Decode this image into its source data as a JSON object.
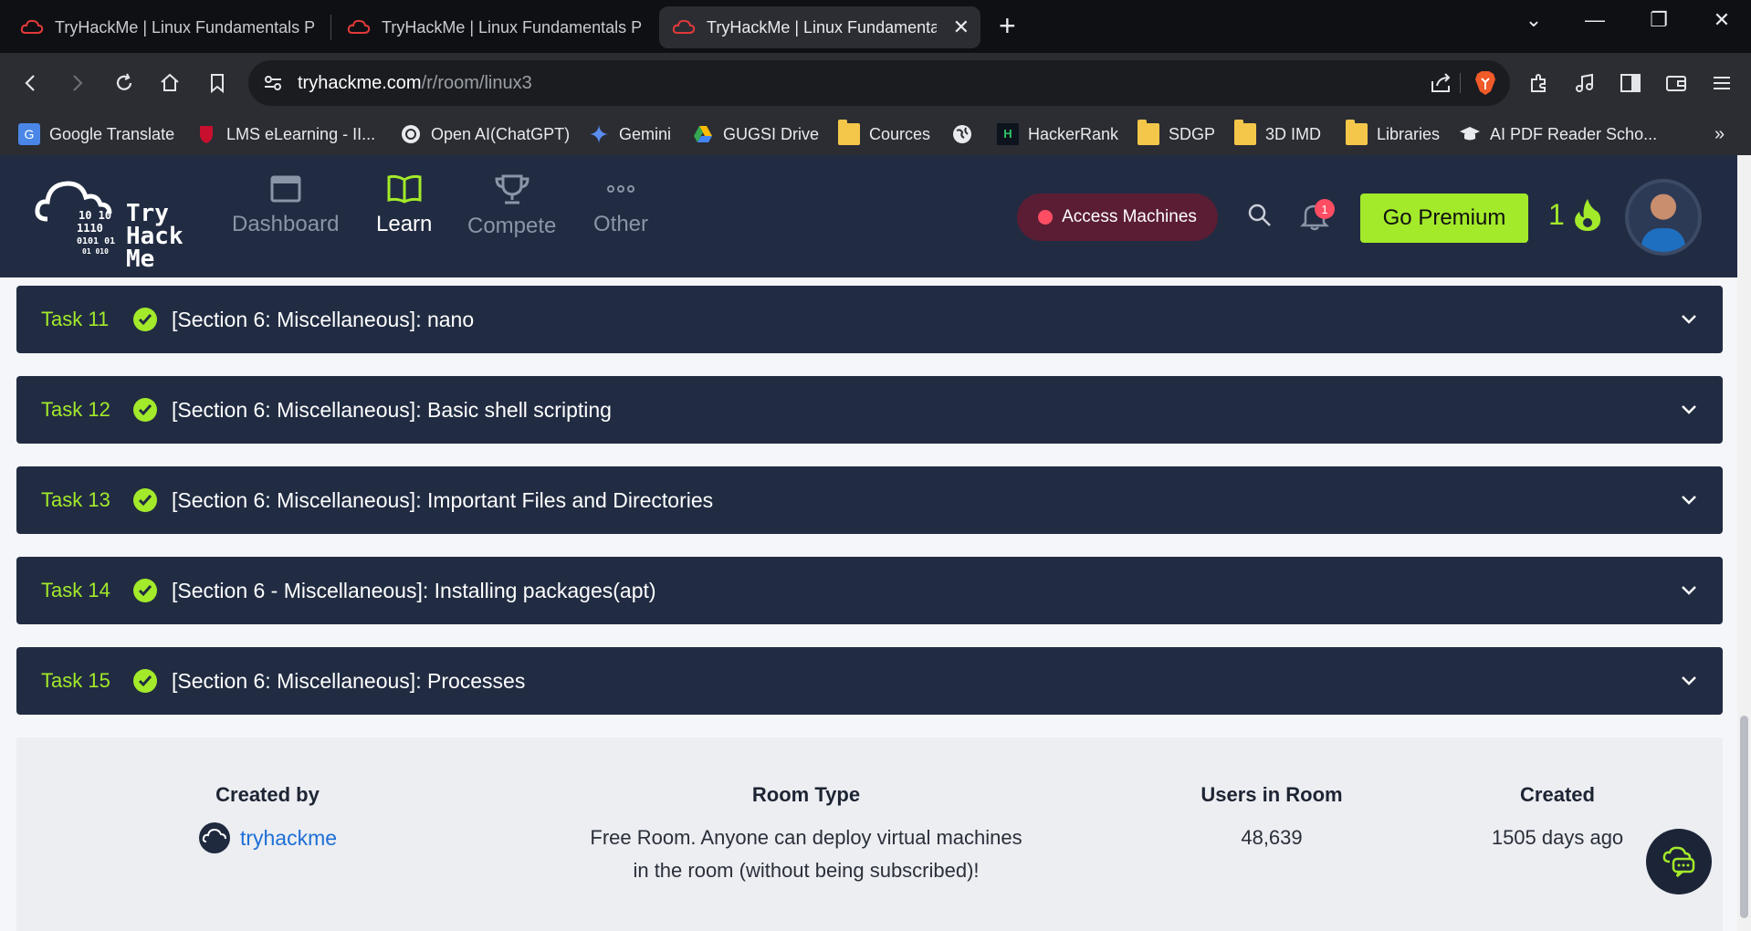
{
  "browser": {
    "tabs": [
      {
        "title": "TryHackMe | Linux Fundamentals Par",
        "active": false
      },
      {
        "title": "TryHackMe | Linux Fundamentals Par",
        "active": false
      },
      {
        "title": "TryHackMe | Linux Fundamental",
        "active": true
      }
    ],
    "url_host": "tryhackme.com",
    "url_path": "/r/room/linux3",
    "bookmarks": [
      {
        "label": "Google Translate",
        "icon": "google-translate-icon"
      },
      {
        "label": "LMS eLearning - II...",
        "icon": "shield-icon"
      },
      {
        "label": "Open AI(ChatGPT)",
        "icon": "openai-icon"
      },
      {
        "label": "Gemini",
        "icon": "gemini-icon"
      },
      {
        "label": "GUGSI Drive",
        "icon": "drive-icon"
      },
      {
        "label": "Cources",
        "icon": "folder-icon"
      },
      {
        "label": "",
        "icon": "globe-icon"
      },
      {
        "label": "HackerRank",
        "icon": "hackerrank-icon"
      },
      {
        "label": "SDGP",
        "icon": "folder-icon"
      },
      {
        "label": "3D IMD",
        "icon": "folder-icon"
      },
      {
        "label": "Libraries",
        "icon": "folder-icon"
      },
      {
        "label": "AI PDF Reader Scho...",
        "icon": "graduation-cap-icon"
      }
    ]
  },
  "header": {
    "logo_text": [
      "Try",
      "Hack",
      "Me"
    ],
    "nav": [
      {
        "label": "Dashboard",
        "icon": "window-icon",
        "active": false
      },
      {
        "label": "Learn",
        "icon": "book-icon",
        "active": true
      },
      {
        "label": "Compete",
        "icon": "trophy-icon",
        "active": false
      },
      {
        "label": "Other",
        "icon": "dots-icon",
        "active": false
      }
    ],
    "access_machines": "Access Machines",
    "notification_count": "1",
    "go_premium": "Go Premium",
    "streak": "1"
  },
  "tasks": [
    {
      "number": "Task 11",
      "title": "[Section 6: Miscellaneous]: nano"
    },
    {
      "number": "Task 12",
      "title": "[Section 6: Miscellaneous]: Basic shell scripting"
    },
    {
      "number": "Task 13",
      "title": "[Section 6: Miscellaneous]: Important Files and Directories"
    },
    {
      "number": "Task 14",
      "title": "[Section 6 - Miscellaneous]: Installing packages(apt)"
    },
    {
      "number": "Task 15",
      "title": "[Section 6: Miscellaneous]: Processes"
    }
  ],
  "room_info": {
    "created_by_label": "Created by",
    "creator": "tryhackme",
    "room_type_label": "Room Type",
    "room_type_line1": "Free Room. Anyone can deploy virtual machines",
    "room_type_line2": "in the room (without being subscribed)!",
    "users_label": "Users in Room",
    "users": "48,639",
    "created_label": "Created",
    "created": "1505 days ago"
  },
  "colors": {
    "accent": "#a3ea2a",
    "header_bg": "#212c42",
    "link": "#1e6fd6"
  }
}
